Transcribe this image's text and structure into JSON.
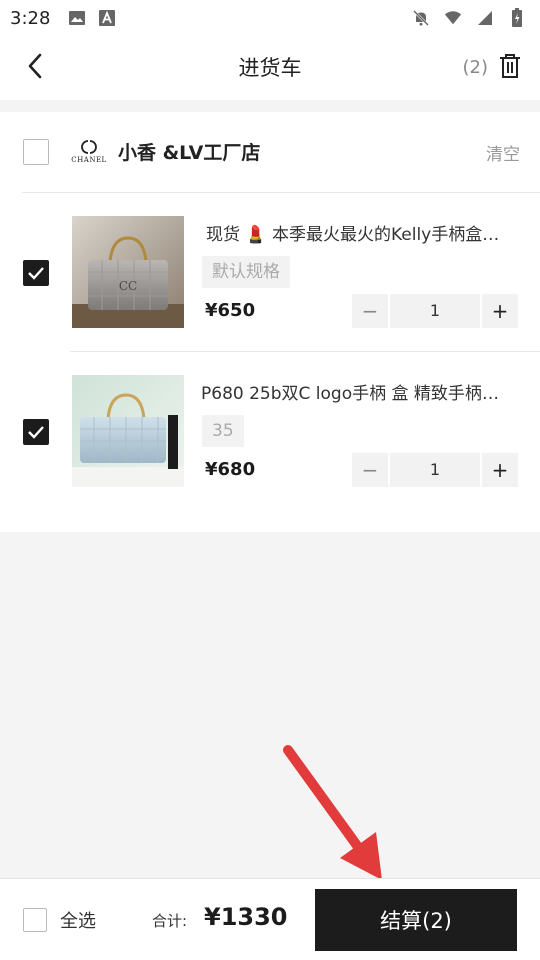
{
  "status_bar": {
    "time": "3:28",
    "left_icons": [
      "image-icon",
      "text-a-icon"
    ],
    "right_icons": [
      "bell-off-icon",
      "wifi-icon",
      "signal-icon",
      "battery-icon"
    ]
  },
  "header": {
    "title": "进货车",
    "count": "(2)",
    "back_icon": "chevron-left-icon",
    "delete_icon": "trash-icon"
  },
  "store": {
    "name": "小香 &LV工厂店",
    "logo_text": "CHANEL",
    "clear_label": "清空",
    "selected": false
  },
  "items": [
    {
      "title": "现货 💄 本季最火最火的Kelly手柄盒子包",
      "spec": "默认规格",
      "price": "¥650",
      "quantity": "1",
      "checked": true
    },
    {
      "title": "P680 25b双C logo手柄 盒 精致手柄盒子包",
      "spec": "35",
      "price": "¥680",
      "quantity": "1",
      "checked": true
    }
  ],
  "stepper": {
    "minus": "−",
    "plus": "+"
  },
  "bottom_bar": {
    "select_all_label": "全选",
    "total_label": "合计:",
    "total_value": "¥1330",
    "checkout_label": "结算(2)"
  },
  "colors": {
    "accent": "#1c1c1c",
    "arrow": "#e23b3b",
    "page_bg": "#f4f4f4"
  }
}
